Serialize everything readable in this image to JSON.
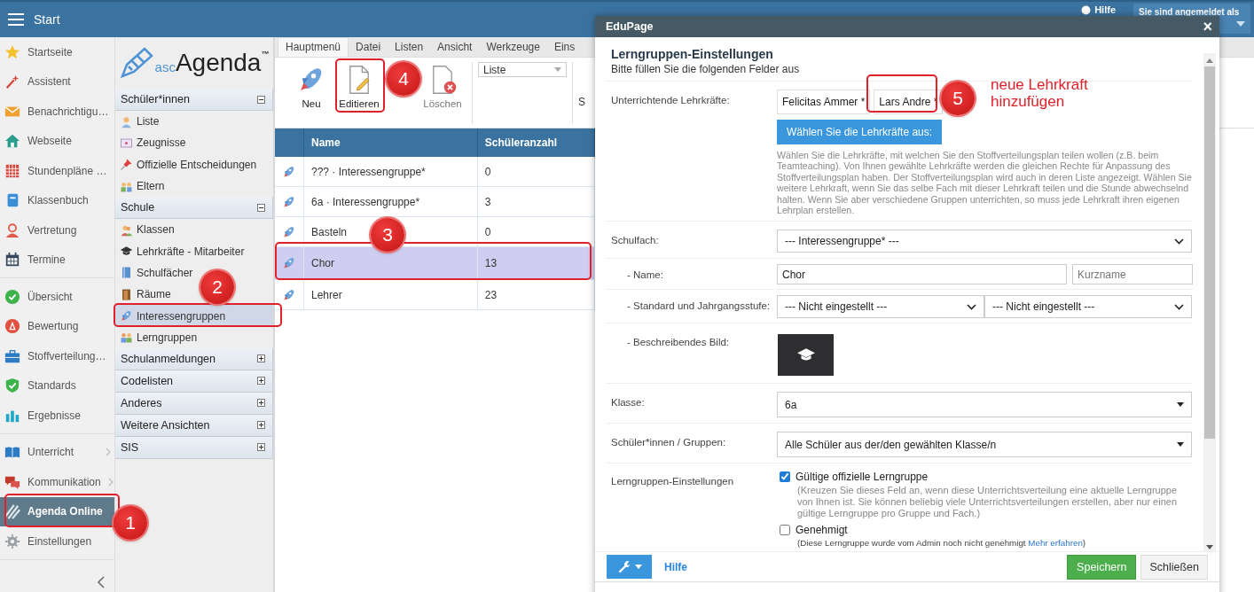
{
  "app_bar": {
    "title": "Start",
    "help": "Hilfe",
    "user_label": "Sie sind angemeldet als"
  },
  "nav_groups": [
    {
      "items": [
        {
          "label": "Startseite",
          "selected": false,
          "has_submenu": false
        },
        {
          "label": "Assistent",
          "selected": false,
          "has_submenu": false
        },
        {
          "label": "Benachrichtigu…",
          "selected": false,
          "has_submenu": false
        },
        {
          "label": "Webseite",
          "selected": false,
          "has_submenu": false
        },
        {
          "label": "Stundenpläne …",
          "selected": false,
          "has_submenu": false
        },
        {
          "label": "Klassenbuch",
          "selected": false,
          "has_submenu": false
        },
        {
          "label": "Vertretung",
          "selected": false,
          "has_submenu": false
        },
        {
          "label": "Termine",
          "selected": false,
          "has_submenu": false
        }
      ]
    },
    {
      "items": [
        {
          "label": "Übersicht",
          "selected": false,
          "has_submenu": false
        },
        {
          "label": "Bewertung",
          "selected": false,
          "has_submenu": false
        },
        {
          "label": "Stoffverteilung…",
          "selected": false,
          "has_submenu": false
        },
        {
          "label": "Standards",
          "selected": false,
          "has_submenu": false
        },
        {
          "label": "Ergebnisse",
          "selected": false,
          "has_submenu": false
        }
      ]
    },
    {
      "items": [
        {
          "label": "Unterricht",
          "selected": false,
          "has_submenu": true
        },
        {
          "label": "Kommunikation",
          "selected": false,
          "has_submenu": true
        },
        {
          "label": "Agenda Online",
          "selected": true,
          "has_submenu": false
        },
        {
          "label": "Einstellungen",
          "selected": false,
          "has_submenu": false
        }
      ]
    }
  ],
  "logo": {
    "prefix": "asc",
    "name": "Agenda",
    "mark": "™"
  },
  "sections": [
    {
      "title": "Schüler*innen",
      "expanded": true,
      "items": [
        {
          "label": "Liste",
          "selected": false
        },
        {
          "label": "Zeugnisse",
          "selected": false
        },
        {
          "label": "Offizielle Entscheidungen",
          "selected": false
        },
        {
          "label": "Eltern",
          "selected": false
        }
      ]
    },
    {
      "title": "Schule",
      "expanded": true,
      "items": [
        {
          "label": "Klassen",
          "selected": false
        },
        {
          "label": "Lehrkräfte - Mitarbeiter",
          "selected": false
        },
        {
          "label": "Schulfächer",
          "selected": false
        },
        {
          "label": "Räume",
          "selected": false
        },
        {
          "label": "Interessengruppen",
          "selected": true
        },
        {
          "label": "Lerngruppen",
          "selected": false
        }
      ]
    },
    {
      "title": "Schulanmeldungen",
      "expanded": false
    },
    {
      "title": "Codelisten",
      "expanded": false
    },
    {
      "title": "Anderes",
      "expanded": false
    },
    {
      "title": "Weitere Ansichten",
      "expanded": false
    },
    {
      "title": "SIS",
      "expanded": false
    }
  ],
  "ribbon": {
    "tabs": [
      {
        "label": "Hauptmenü",
        "selected": true
      },
      {
        "label": "Datei",
        "selected": false
      },
      {
        "label": "Listen",
        "selected": false
      },
      {
        "label": "Ansicht",
        "selected": false
      },
      {
        "label": "Werkzeuge",
        "selected": false
      },
      {
        "label": "Eins",
        "selected": false
      }
    ],
    "buttons": [
      {
        "label": "Neu",
        "disabled": false
      },
      {
        "label": "Editieren",
        "disabled": false
      },
      {
        "label": "Löschen",
        "disabled": true
      }
    ],
    "view_select": "Liste",
    "cut_button": "S"
  },
  "table": {
    "columns": [
      "Name",
      "Schüleranzahl"
    ],
    "rows": [
      {
        "name": "??? · Interessengruppe*",
        "count": "0",
        "selected": false
      },
      {
        "name": "6a · Interessengruppe*",
        "count": "3",
        "selected": false
      },
      {
        "name": "Basteln",
        "count": "0",
        "selected": false
      },
      {
        "name": "Chor",
        "count": "13",
        "selected": true
      },
      {
        "name": "Lehrer",
        "count": "23",
        "selected": false
      }
    ]
  },
  "dialog": {
    "app": "EduPage",
    "close": "×",
    "title": "Lerngruppen-Einstellungen",
    "subtitle": "Bitte füllen Sie die folgenden Felder aus",
    "teachers": {
      "label": "Unterrichtende Lehrkräfte:",
      "chips": [
        "Felicitas Ammer *",
        "Lars Andre *"
      ],
      "button": "Wählen Sie die Lehrkräfte aus:",
      "help": "Wählen Sie die Lehrkräfte, mit welchen Sie den Stoffverteilungsplan teilen wollen (z.B. beim Teamteaching). Von Ihnen gewählte Lehrkräfte werden die gleichen Rechte für Anpassung des Stoffverteilungsplan haben. Der Stoffverteilungsplan wird auch in deren Liste angezeigt. Wählen Sie weitere Lehrkraft, wenn Sie das selbe Fach mit dieser Lehrkraft teilen und die Stunde abwechselnd halten. Wenn Sie aber verschiedene Gruppen unterrichten, so muss jede Lehrkraft ihren eigenen Lehrplan erstellen."
    },
    "subject": {
      "label": "Schulfach:",
      "value": "--- Interessengruppe* ---"
    },
    "name": {
      "label": "- Name:",
      "value": "Chor",
      "short_placeholder": "Kurzname"
    },
    "standard": {
      "label": "- Standard und Jahrgangsstufe:",
      "values": [
        "--- Nicht eingestellt ---",
        "--- Nicht eingestellt ---"
      ]
    },
    "image": {
      "label": "- Beschreibendes Bild:"
    },
    "klasse": {
      "label": "Klasse:",
      "value": "6a"
    },
    "students": {
      "label": "Schüler*innen / Gruppen:",
      "value": "Alle Schüler aus der/den gewählten Klasse/n"
    },
    "settings": {
      "label": "Lerngruppen-Einstellungen",
      "options": [
        {
          "label": "Gültige offizielle Lerngruppe",
          "checked": true,
          "note": "(Kreuzen Sie dieses Feld an, wenn diese Unterrichtsverteilung eine aktuelle Lerngruppe von Ihnen ist. Sie können beliebig viele Unterrichtsverteilungen erstellen, aber nur einen gültige Lerngruppe pro Gruppe und Fach.)"
        },
        {
          "label": "Genehmigt",
          "checked": false,
          "note": "(Diese Lerngruppe wurde vom Admin noch nicht genehmigt",
          "link": "Mehr erfahren",
          "note_end": ")"
        }
      ]
    },
    "footer": {
      "help": "Hilfe",
      "save": "Speichern",
      "close": "Schließen"
    }
  },
  "annotations": [
    {
      "number": "1"
    },
    {
      "number": "2"
    },
    {
      "number": "3"
    },
    {
      "number": "4"
    },
    {
      "number": "5"
    }
  ],
  "annotation_note": [
    "neue Lehrkraft",
    "hinzufügen"
  ]
}
